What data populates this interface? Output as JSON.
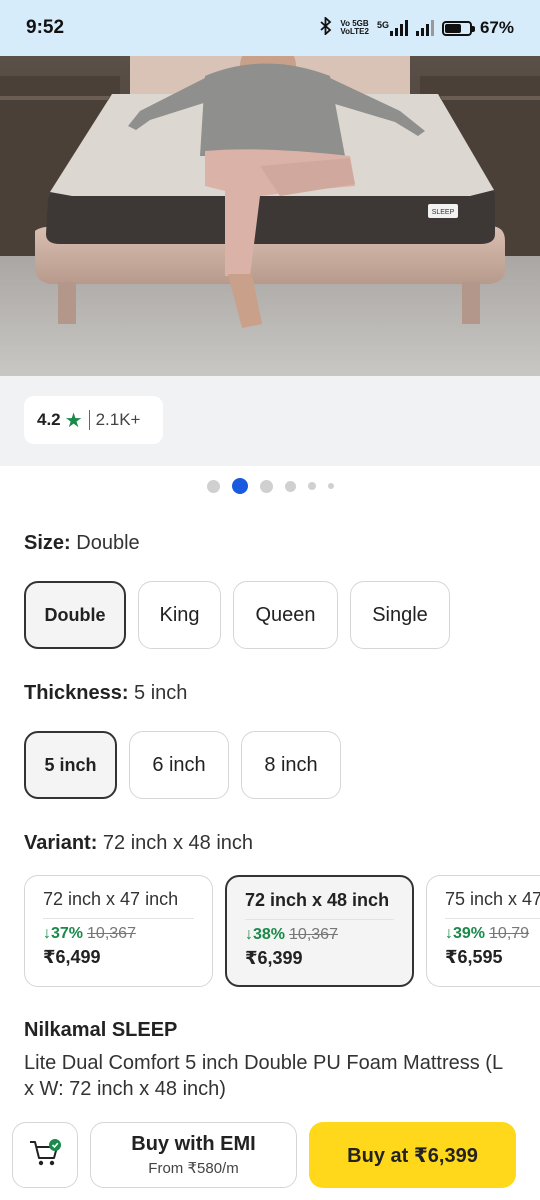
{
  "status_bar": {
    "time": "9:52",
    "network_line1": "Vo 5GB",
    "network_line2": "VoLTE2",
    "signal_label": "5G",
    "battery": "67%",
    "battery_level": 0.67
  },
  "product_image": {
    "carousel_total": 6,
    "carousel_active": 1,
    "mattress_label": "SLEEP"
  },
  "rating": {
    "value": "4.2",
    "star": "★",
    "count": "2.1K+"
  },
  "size": {
    "label": "Size:",
    "selected": "Double",
    "options": [
      "Double",
      "King",
      "Queen",
      "Single"
    ]
  },
  "thickness": {
    "label": "Thickness:",
    "selected": "5 inch",
    "options": [
      "5 inch",
      "6 inch",
      "8 inch"
    ]
  },
  "variant": {
    "label": "Variant:",
    "selected": "72 inch x 48 inch",
    "options": [
      {
        "name": "72 inch x 47 inch",
        "discount": "↓37%",
        "mrp": "10,367",
        "price": "₹6,499"
      },
      {
        "name": "72 inch x 48 inch",
        "discount": "↓38%",
        "mrp": "10,367",
        "price": "₹6,399"
      },
      {
        "name": "75 inch x 47",
        "discount": "↓39%",
        "mrp": "10,79",
        "price": "₹6,595"
      }
    ]
  },
  "product": {
    "brand": "Nilkamal SLEEP",
    "title": "Lite Dual Comfort 5 inch Double PU Foam Mattress (L x W: 72 inch x 48 inch)"
  },
  "bottom_bar": {
    "emi_label": "Buy with EMI",
    "emi_sub": "From ₹580/m",
    "buy_label": "Buy at ₹6,399"
  },
  "colors": {
    "accent_yellow": "#ffd81b",
    "discount_green": "#1a8a4a",
    "carousel_active": "#1a5ae0",
    "status_bar_bg": "#d7ecfb"
  }
}
